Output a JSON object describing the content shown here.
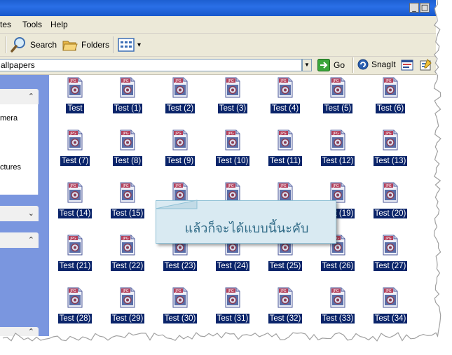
{
  "window": {
    "title_minimize": "_",
    "title_maximize": "□"
  },
  "menu": [
    "tes",
    "Tools",
    "Help"
  ],
  "toolbar": {
    "search_label": "Search",
    "folders_label": "Folders",
    "views_dropdown": "▾"
  },
  "address": {
    "value": "allpapers",
    "go_label": "Go",
    "snagit_label": "SnagIt"
  },
  "left_pane": {
    "panel1_items": [
      "mera",
      "ctures"
    ],
    "collapse_up": "⌃",
    "expand_down": "⌄"
  },
  "files": [
    "Test",
    "Test (1)",
    "Test (2)",
    "Test (3)",
    "Test (4)",
    "Test (5)",
    "Test (6)",
    "Test (7)",
    "Test (8)",
    "Test (9)",
    "Test (10)",
    "Test (11)",
    "Test (12)",
    "Test (13)",
    "Test (14)",
    "Test (15)",
    "",
    "",
    "",
    "Test (19)",
    "Test (20)",
    "Test (21)",
    "Test (22)",
    "Test (23)",
    "Test (24)",
    "Test (25)",
    "Test (26)",
    "Test (27)",
    "Test (28)",
    "Test (29)",
    "Test (30)",
    "Test (31)",
    "Test (32)",
    "Test (33)",
    "Test (34)"
  ],
  "file_type_badge": "JPG",
  "callout": {
    "text": "แล้วก็จะได้แบบนี้นะคับ"
  },
  "colors": {
    "selection": "#0a246a",
    "titlebar": "#2a6fe6",
    "callout_bg": "#d9eaf2",
    "callout_text": "#2f6a86"
  }
}
